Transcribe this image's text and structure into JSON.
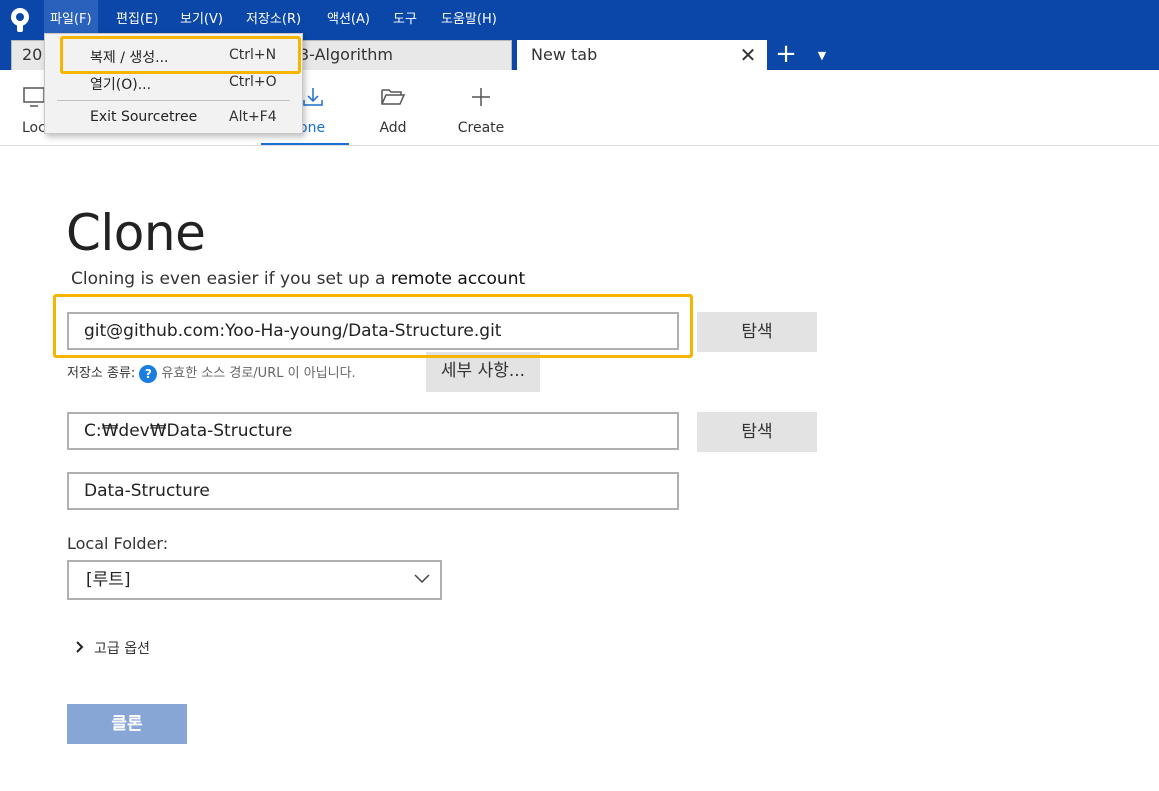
{
  "menubar": {
    "logo_icon": "sourcetree-logo-icon",
    "items": [
      {
        "label": "파일(F)"
      },
      {
        "label": "편집(E)"
      },
      {
        "label": "보기(V)"
      },
      {
        "label": "저장소(R)"
      },
      {
        "label": "액션(A)"
      },
      {
        "label": "도구"
      },
      {
        "label": "도움말(H)"
      }
    ]
  },
  "file_menu": {
    "items": [
      {
        "label": "복제 / 생성...",
        "shortcut": "Ctrl+N"
      },
      {
        "label": "열기(O)...",
        "shortcut": "Ctrl+O"
      },
      {
        "label": "Exit Sourcetree",
        "shortcut": "Alt+F4"
      }
    ]
  },
  "tabs": [
    {
      "label": "20"
    },
    {
      "label": "3-Algorithm"
    },
    {
      "label": "New tab"
    }
  ],
  "tab_close_symbol": "✕",
  "tab_add_symbol": "+",
  "tab_menu_symbol": "▼",
  "toolbar": {
    "items": [
      {
        "label": "Loc",
        "icon": "monitor-icon"
      },
      {
        "label": "one",
        "icon": "download-icon"
      },
      {
        "label": "Add",
        "icon": "folder-open-icon"
      },
      {
        "label": "Create",
        "icon": "plus-icon"
      }
    ]
  },
  "clone_page": {
    "title": "Clone",
    "subtitle_prefix": "Cloning is even easier if you set up a ",
    "subtitle_link": "remote account",
    "source_url": "git@github.com:Yoo-Ha-young/Data-Structure.git",
    "browse_label": "탐색",
    "repo_type_label": "저장소 종류:",
    "repo_type_help": "?",
    "repo_type_status": "유효한 소스 경로/URL 이 아닙니다.",
    "details_label": "세부 사항...",
    "destination_path": "C:₩dev₩Data-Structure",
    "browse_label_2": "탐색",
    "name": "Data-Structure",
    "local_folder_label": "Local Folder:",
    "local_folder_value": "[루트]",
    "advanced_label": "고급 옵션",
    "clone_button": "클론"
  },
  "colors": {
    "menubar_bg": "#0a47a8",
    "highlight": "#f7b500",
    "accent": "#1a6fd0",
    "clone_button_disabled": "#87a6d6"
  }
}
